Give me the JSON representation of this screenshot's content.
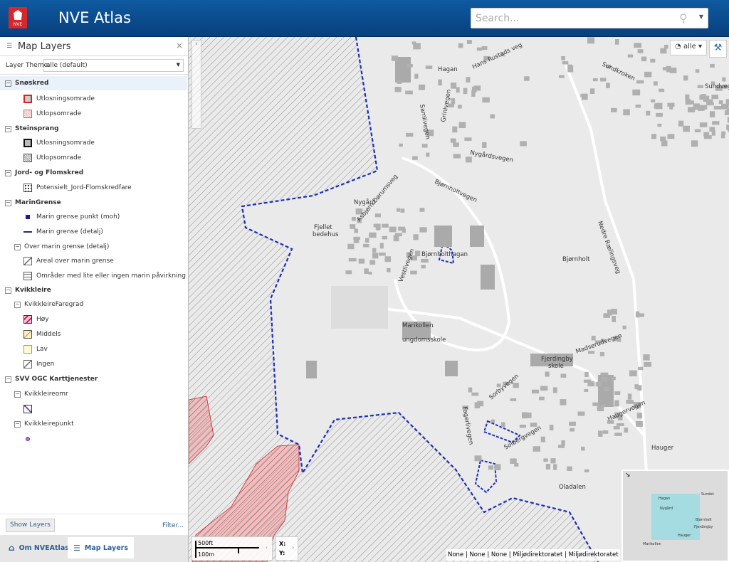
{
  "header": {
    "title": "NVE Atlas",
    "logo_text": "NVE",
    "search_placeholder": "Search..."
  },
  "panel": {
    "title": "Map Layers",
    "theme_label": "Layer Theme:",
    "theme_value": "alle (default)",
    "tree": [
      {
        "label": "Snøskred",
        "level": 0,
        "group": true
      },
      {
        "label": "Utlosningsomrade",
        "level": 2,
        "sym": "red-box"
      },
      {
        "label": "Utlopsomrade",
        "level": 2,
        "sym": "red-dots"
      },
      {
        "label": "Steinsprang",
        "level": 0,
        "group": true
      },
      {
        "label": "Utlosningsomrade",
        "level": 2,
        "sym": "black-box"
      },
      {
        "label": "Utlopsomrade",
        "level": 2,
        "sym": "black-dots"
      },
      {
        "label": "Jord- og Flomskred",
        "level": 0,
        "group": true
      },
      {
        "label": "Potensielt_Jord-Flomskredfare",
        "level": 2,
        "sym": "dots"
      },
      {
        "label": "MarinGrense",
        "level": 0,
        "group": true
      },
      {
        "label": "Marin grense punkt (moh)",
        "level": 2,
        "sym": "blue-square"
      },
      {
        "label": "Marin grense (detalj)",
        "level": 2,
        "sym": "blue-dash"
      },
      {
        "label": "Over marin grense (detalj)",
        "level": 1,
        "group": true
      },
      {
        "label": "Areal over marin grense",
        "level": 3,
        "sym": "hatch"
      },
      {
        "label": "Områder med lite eller ingen marin påvirkning",
        "level": 3,
        "sym": "lines"
      },
      {
        "label": "Kvikkleire",
        "level": 0,
        "group": true
      },
      {
        "label": "KvikkleireFaregrad",
        "level": 1,
        "group": true
      },
      {
        "label": "Høy",
        "level": 3,
        "sym": "hatch-red"
      },
      {
        "label": "Middels",
        "level": 3,
        "sym": "hatch-yellow"
      },
      {
        "label": "Lav",
        "level": 3,
        "sym": "yellow"
      },
      {
        "label": "Ingen",
        "level": 3,
        "sym": "hatch"
      },
      {
        "label": "SVV OGC Karttjenester",
        "level": 0,
        "group": true
      },
      {
        "label": "Kvikkleireomr",
        "level": 1,
        "group": true
      },
      {
        "label": "",
        "level": 3,
        "sym": "purple-hatch"
      },
      {
        "label": "Kvikkleirepunkt",
        "level": 1,
        "group": true
      },
      {
        "label": "",
        "level": 3,
        "sym": "purple-dot"
      }
    ],
    "show_layers": "Show Layers",
    "filter": "Filter...",
    "tabs": [
      {
        "label": "Om NVEAtlas",
        "icon": "home-icon"
      },
      {
        "label": "Map Layers",
        "icon": "layers-icon",
        "active": true
      }
    ]
  },
  "map": {
    "layer_select": "alle",
    "scale_ft": "500ft",
    "scale_m": "100m",
    "x_label": "X:",
    "y_label": "Y:",
    "attribution": "None | None | None | Miljødirektoratet | Miljødirektoratet | Miljø",
    "places": [
      "Hagan",
      "Nygård",
      "Fjellet bedehus",
      "Bjørnholthagan",
      "Bjørnholt",
      "Marikollen ungdomsskole",
      "Fjerdingby skole",
      "Hauger",
      "Oladalen",
      "Sundvegen",
      "Nygårdsvegen",
      "Bjørnholtvegen",
      "Nedre Rælingsveg",
      "Sundkroken",
      "Hans Rustads veg",
      "Grinivegen",
      "Samlivegen",
      "Asbjørn Dørumsveg",
      "Vestlivegen",
      "Madserudvegen",
      "Haugervegen",
      "Sorbyvegen",
      "Fagerlivegen",
      "Solbergvegen"
    ],
    "overview_places": [
      "Hagan",
      "Nygård",
      "Bjørnholt",
      "Fjerdingby",
      "Hauger",
      "Sundet",
      "Marikollen"
    ],
    "colors": {
      "boundary": "#1a2fb8",
      "hatch_red": "#cc2222",
      "overview_box": "#78dce6"
    }
  }
}
